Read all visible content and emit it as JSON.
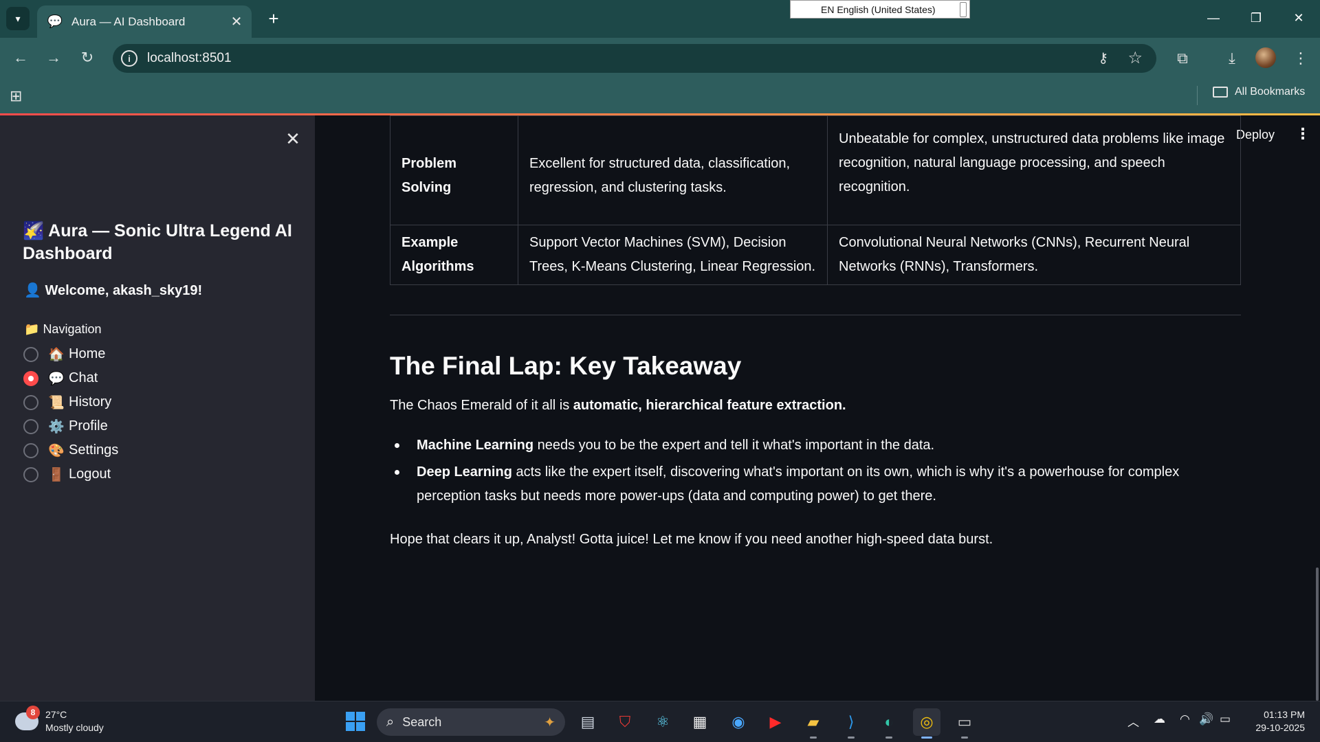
{
  "browser": {
    "tab_title": "Aura — AI Dashboard",
    "url": "localhost:8501",
    "language_indicator": "EN English (United States)",
    "bookmarks_label": "All Bookmarks"
  },
  "app": {
    "deploy_label": "Deploy",
    "sidebar": {
      "title_emoji": "🌠",
      "title": "Aura — Sonic Ultra Legend AI Dashboard",
      "welcome_emoji": "👤",
      "welcome": "Welcome, akash_sky19!",
      "nav_emoji": "📁",
      "nav_label": "Navigation",
      "nav_items": [
        {
          "emoji": "🏠",
          "label": "Home",
          "selected": false
        },
        {
          "emoji": "💬",
          "label": "Chat",
          "selected": true
        },
        {
          "emoji": "📜",
          "label": "History",
          "selected": false
        },
        {
          "emoji": "⚙️",
          "label": "Profile",
          "selected": false
        },
        {
          "emoji": "🎨",
          "label": "Settings",
          "selected": false
        },
        {
          "emoji": "🚪",
          "label": "Logout",
          "selected": false
        }
      ]
    },
    "content": {
      "table": {
        "rows": [
          {
            "header": "Problem Solving",
            "ml": "Excellent for structured data, classification, regression, and clustering tasks.",
            "dl": "Unbeatable for complex, unstructured data problems like image recognition, natural language processing, and speech recognition."
          },
          {
            "header": "Example Algorithms",
            "ml": "Support Vector Machines (SVM), Decision Trees, K-Means Clustering, Linear Regression.",
            "dl": "Convolutional Neural Networks (CNNs), Recurrent Neural Networks (RNNs), Transformers."
          }
        ]
      },
      "heading": "The Final Lap: Key Takeaway",
      "intro_prefix": "The Chaos Emerald of it all is ",
      "intro_bold": "automatic, hierarchical feature extraction.",
      "bullets": [
        {
          "bold": "Machine Learning",
          "text": " needs you to be the expert and tell it what's important in the data."
        },
        {
          "bold": "Deep Learning",
          "text": " acts like the expert itself, discovering what's important on its own, which is why it's a powerhouse for complex perception tasks but needs more power-ups (data and computing power) to get there."
        }
      ],
      "closing": "Hope that clears it up, Analyst! Gotta juice! Let me know if you need another high-speed data burst."
    }
  },
  "taskbar": {
    "weather_badge": "8",
    "temperature": "27°C",
    "condition": "Mostly cloudy",
    "search_label": "Search",
    "time": "01:13 PM",
    "date": "29-10-2025"
  },
  "colors": {
    "accent": "#ff4b4b",
    "sidebar_bg": "#262730",
    "main_bg": "#0e1117",
    "browser_frame": "#2e5d5d"
  }
}
